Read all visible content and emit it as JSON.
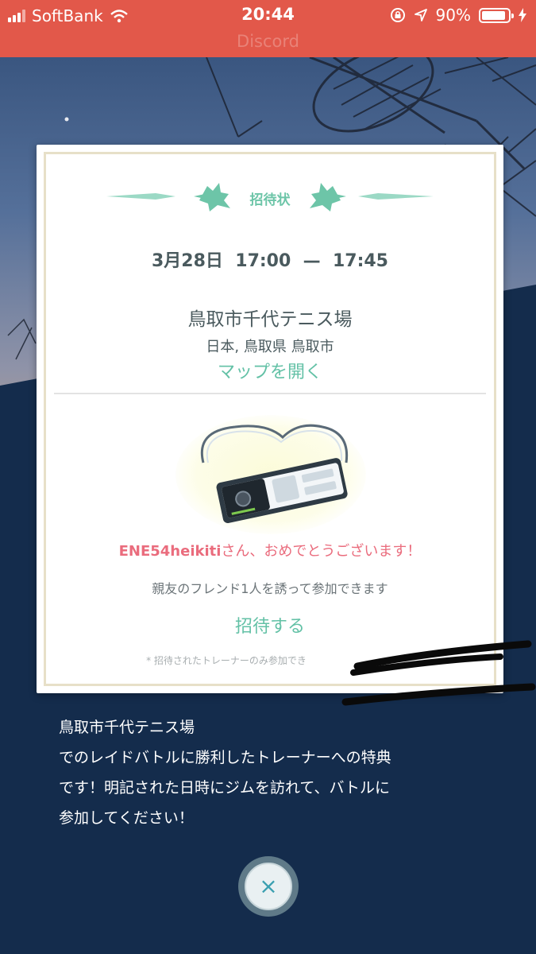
{
  "status_bar": {
    "carrier": "SoftBank",
    "time": "20:44",
    "battery": "90%",
    "battery_level": 0.9,
    "app_label": "Discord",
    "bar_color": "#e2584a"
  },
  "invitation": {
    "header_title": "招待状",
    "date": "3月28日",
    "start_time": "17:00",
    "separator": "—",
    "end_time": "17:45",
    "place_name": "鳥取市千代テニス場",
    "region": "日本, 鳥取県 鳥取市",
    "open_map_label": "マップを開く",
    "congrats_name": "ENE54heikiti",
    "congrats_text": "さん、おめでとうございます！",
    "info_text": "親友のフレンド1人を誘って参加できます",
    "invite_label": "招待する",
    "footnote": "* 招待されたトレーナーのみ参加でき"
  },
  "description": {
    "line1": "鳥取市千代テニス場",
    "line2": "でのレイドバトルに勝利したトレーナーへの特典",
    "line3": "です！明記された日時にジムを訪れて、バトルに",
    "line4": "参加してください！"
  },
  "close_button": {
    "label": "×"
  },
  "colors": {
    "accent_teal": "#63c1a6",
    "congrats_pink": "#ea6c7d",
    "background_navy": "#142c4c"
  }
}
